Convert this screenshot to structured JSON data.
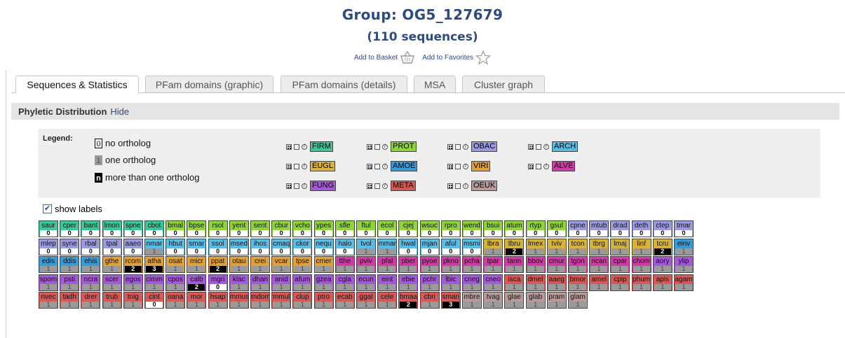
{
  "header": {
    "title": "Group: OG5_127679",
    "subtitle": "(110 sequences)",
    "add_basket": "Add to Basket",
    "add_favorites": "Add to Favorites"
  },
  "tabs": [
    {
      "label": "Sequences & Statistics",
      "active": true
    },
    {
      "label": "PFam domains (graphic)",
      "active": false
    },
    {
      "label": "PFam domains (details)",
      "active": false
    },
    {
      "label": "MSA",
      "active": false
    },
    {
      "label": "Cluster graph",
      "active": false
    }
  ],
  "section": {
    "title": "Phyletic Distribution",
    "toggle": "Hide"
  },
  "legend": {
    "title": "Legend:",
    "items": [
      {
        "symbol": "0",
        "label": "no ortholog"
      },
      {
        "symbol": "1",
        "label": "one ortholog"
      },
      {
        "symbol": "n",
        "label": "more than one ortholog"
      }
    ],
    "groups": [
      {
        "name": "FIRM",
        "color": "#3cc79a"
      },
      {
        "name": "PROT",
        "color": "#8fd43c"
      },
      {
        "name": "OBAC",
        "color": "#9a9ae0"
      },
      {
        "name": "ARCH",
        "color": "#5bbde6"
      },
      {
        "name": "EUGL",
        "color": "#d6b23c"
      },
      {
        "name": "AMOE",
        "color": "#3a9ad6"
      },
      {
        "name": "VIRI",
        "color": "#e1a13a"
      },
      {
        "name": "ALVE",
        "color": "#cf3ca6"
      },
      {
        "name": "FUNG",
        "color": "#a45ad6"
      },
      {
        "name": "META",
        "color": "#d45a58"
      },
      {
        "name": "OEUK",
        "color": "#b89a9a"
      }
    ]
  },
  "show_labels": {
    "label": "show labels",
    "checked": true
  },
  "colors": {
    "FIRM": "#3cc79a",
    "PROT": "#8fd43c",
    "OBAC": "#9a9ae0",
    "ARCH": "#5bbde6",
    "EUGL": "#d6b23c",
    "AMOE": "#3a9ad6",
    "VIRI": "#e1a13a",
    "ALVE": "#cf3ca6",
    "FUNG": "#a45ad6",
    "META": "#d45a58",
    "OEUK": "#b89a9a"
  },
  "rows": [
    [
      [
        "saur",
        "FIRM",
        "0"
      ],
      [
        "cper",
        "FIRM",
        "0"
      ],
      [
        "bant",
        "FIRM",
        "0"
      ],
      [
        "lmon",
        "FIRM",
        "0"
      ],
      [
        "spne",
        "FIRM",
        "0"
      ],
      [
        "cbot",
        "FIRM",
        "0"
      ],
      [
        "bmal",
        "PROT",
        "0"
      ],
      [
        "bpse",
        "PROT",
        "0"
      ],
      [
        "rsol",
        "PROT",
        "0"
      ],
      [
        "yent",
        "PROT",
        "0"
      ],
      [
        "sent",
        "PROT",
        "0"
      ],
      [
        "cbur",
        "PROT",
        "0"
      ],
      [
        "vcho",
        "PROT",
        "0"
      ],
      [
        "ypes",
        "PROT",
        "0"
      ],
      [
        "sfle",
        "PROT",
        "0"
      ],
      [
        "ftul",
        "PROT",
        "0"
      ],
      [
        "ecol",
        "PROT",
        "0"
      ],
      [
        "cjej",
        "PROT",
        "0"
      ],
      [
        "wsuc",
        "PROT",
        "0"
      ],
      [
        "rpro",
        "PROT",
        "0"
      ],
      [
        "wend",
        "PROT",
        "0"
      ],
      [
        "bsui",
        "PROT",
        "0"
      ],
      [
        "atum",
        "PROT",
        "0"
      ],
      [
        "rtyp",
        "PROT",
        "0"
      ],
      [
        "gsul",
        "PROT",
        "0"
      ],
      [
        "cpne",
        "OBAC",
        "0"
      ],
      [
        "mtub",
        "OBAC",
        "0"
      ],
      [
        "drad",
        "OBAC",
        "0"
      ],
      [
        "deth",
        "OBAC",
        "0"
      ],
      [
        "ctep",
        "OBAC",
        "0"
      ],
      [
        "tmar",
        "OBAC",
        "0"
      ]
    ],
    [
      [
        "mlep",
        "OBAC",
        "0"
      ],
      [
        "syne",
        "OBAC",
        "0"
      ],
      [
        "rbal",
        "OBAC",
        "0"
      ],
      [
        "tpal",
        "OBAC",
        "0"
      ],
      [
        "aaeo",
        "OBAC",
        "0"
      ],
      [
        "nmar",
        "ARCH",
        "1"
      ],
      [
        "hbut",
        "ARCH",
        "0"
      ],
      [
        "smar",
        "ARCH",
        "0"
      ],
      [
        "ssol",
        "ARCH",
        "0"
      ],
      [
        "msed",
        "ARCH",
        "0"
      ],
      [
        "ihos",
        "ARCH",
        "0"
      ],
      [
        "cmaq",
        "ARCH",
        "0"
      ],
      [
        "ckor",
        "ARCH",
        "0"
      ],
      [
        "nequ",
        "ARCH",
        "0"
      ],
      [
        "halo",
        "ARCH",
        "0"
      ],
      [
        "tvol",
        "ARCH",
        "1"
      ],
      [
        "mmar",
        "ARCH",
        "1"
      ],
      [
        "hwal",
        "ARCH",
        "0"
      ],
      [
        "mjan",
        "ARCH",
        "0"
      ],
      [
        "aful",
        "ARCH",
        "0"
      ],
      [
        "msmi",
        "ARCH",
        "0"
      ],
      [
        "lbra",
        "EUGL",
        "1"
      ],
      [
        "tbru",
        "EUGL",
        "2"
      ],
      [
        "lmex",
        "EUGL",
        "1"
      ],
      [
        "tviv",
        "EUGL",
        "1"
      ],
      [
        "tcon",
        "EUGL",
        "1"
      ],
      [
        "tbrg",
        "EUGL",
        "1"
      ],
      [
        "lmaj",
        "EUGL",
        "1"
      ],
      [
        "linf",
        "EUGL",
        "1"
      ],
      [
        "tcru",
        "EUGL",
        "2"
      ],
      [
        "einv",
        "AMOE",
        "1"
      ]
    ],
    [
      [
        "edis",
        "AMOE",
        "1"
      ],
      [
        "ddis",
        "AMOE",
        "1"
      ],
      [
        "ehis",
        "AMOE",
        "1"
      ],
      [
        "gthe",
        "VIRI",
        "1"
      ],
      [
        "rcom",
        "VIRI",
        "2"
      ],
      [
        "atha",
        "VIRI",
        "3"
      ],
      [
        "osat",
        "VIRI",
        "1"
      ],
      [
        "micr",
        "VIRI",
        "1"
      ],
      [
        "ppat",
        "VIRI",
        "2"
      ],
      [
        "otau",
        "VIRI",
        "1"
      ],
      [
        "crei",
        "VIRI",
        "1"
      ],
      [
        "vcar",
        "VIRI",
        "1"
      ],
      [
        "tpse",
        "VIRI",
        "1"
      ],
      [
        "cmer",
        "VIRI",
        "1"
      ],
      [
        "tthe",
        "ALVE",
        "1"
      ],
      [
        "pviv",
        "ALVE",
        "1"
      ],
      [
        "pfal",
        "ALVE",
        "1"
      ],
      [
        "pber",
        "ALVE",
        "1"
      ],
      [
        "pyoe",
        "ALVE",
        "1"
      ],
      [
        "pkno",
        "ALVE",
        "1"
      ],
      [
        "pcha",
        "ALVE",
        "1"
      ],
      [
        "tpar",
        "ALVE",
        "1"
      ],
      [
        "tann",
        "ALVE",
        "1"
      ],
      [
        "bbov",
        "ALVE",
        "1"
      ],
      [
        "cmur",
        "ALVE",
        "1"
      ],
      [
        "tgon",
        "ALVE",
        "1"
      ],
      [
        "ncan",
        "ALVE",
        "1"
      ],
      [
        "cpar",
        "ALVE",
        "1"
      ],
      [
        "chom",
        "ALVE",
        "1"
      ],
      [
        "aory",
        "FUNG",
        "1"
      ],
      [
        "ylip",
        "FUNG",
        "1"
      ]
    ],
    [
      [
        "spom",
        "FUNG",
        "1"
      ],
      [
        "psti",
        "FUNG",
        "1"
      ],
      [
        "ncra",
        "FUNG",
        "1"
      ],
      [
        "scer",
        "FUNG",
        "1"
      ],
      [
        "egos",
        "FUNG",
        "1"
      ],
      [
        "cimm",
        "FUNG",
        "1"
      ],
      [
        "cpos",
        "FUNG",
        "1"
      ],
      [
        "calb",
        "FUNG",
        "2"
      ],
      [
        "mgri",
        "FUNG",
        "0"
      ],
      [
        "klac",
        "FUNG",
        "1"
      ],
      [
        "dhan",
        "FUNG",
        "1"
      ],
      [
        "anid",
        "FUNG",
        "1"
      ],
      [
        "afum",
        "FUNG",
        "1"
      ],
      [
        "gzea",
        "FUNG",
        "1"
      ],
      [
        "cgla",
        "FUNG",
        "1"
      ],
      [
        "ecun",
        "FUNG",
        "1"
      ],
      [
        "eint",
        "FUNG",
        "1"
      ],
      [
        "ebie",
        "FUNG",
        "1"
      ],
      [
        "pchr",
        "FUNG",
        "1"
      ],
      [
        "lbic",
        "FUNG",
        "1"
      ],
      [
        "cneg",
        "FUNG",
        "1"
      ],
      [
        "cneo",
        "FUNG",
        "1"
      ],
      [
        "isca",
        "META",
        "1"
      ],
      [
        "dmel",
        "META",
        "1"
      ],
      [
        "aaeg",
        "META",
        "1"
      ],
      [
        "bmor",
        "META",
        "1"
      ],
      [
        "amel",
        "META",
        "1"
      ],
      [
        "cpip",
        "META",
        "1"
      ],
      [
        "phum",
        "META",
        "1"
      ],
      [
        "apis",
        "META",
        "1"
      ],
      [
        "agam",
        "META",
        "1"
      ]
    ],
    [
      [
        "nvec",
        "META",
        "1"
      ],
      [
        "tadh",
        "META",
        "1"
      ],
      [
        "drer",
        "META",
        "1"
      ],
      [
        "trub",
        "META",
        "1"
      ],
      [
        "tnig",
        "META",
        "1"
      ],
      [
        "cint",
        "META",
        "0"
      ],
      [
        "oana",
        "META",
        "1"
      ],
      [
        "mor",
        "META",
        "1"
      ],
      [
        "hsap",
        "META",
        "1"
      ],
      [
        "mmus",
        "META",
        "1"
      ],
      [
        "mdom",
        "META",
        "1"
      ],
      [
        "mmul",
        "META",
        "1"
      ],
      [
        "clup",
        "META",
        "1"
      ],
      [
        "ptro",
        "META",
        "1"
      ],
      [
        "ecab",
        "META",
        "1"
      ],
      [
        "ggal",
        "META",
        "1"
      ],
      [
        "cele",
        "META",
        "1"
      ],
      [
        "bmaa",
        "META",
        "2"
      ],
      [
        "cbri",
        "META",
        "1"
      ],
      [
        "sman",
        "META",
        "3"
      ],
      [
        "mbre",
        "OEUK",
        "1"
      ],
      [
        "tvag",
        "OEUK",
        "1"
      ],
      [
        "glae",
        "OEUK",
        "1"
      ],
      [
        "glab",
        "OEUK",
        "1"
      ],
      [
        "pram",
        "OEUK",
        "1"
      ],
      [
        "glam",
        "OEUK",
        "1"
      ]
    ]
  ]
}
